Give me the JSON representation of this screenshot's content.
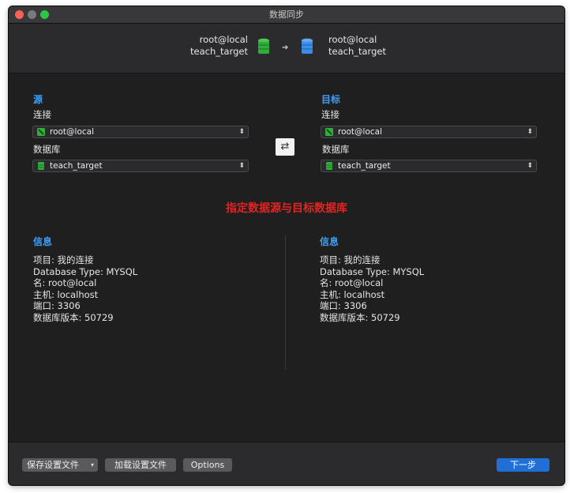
{
  "window": {
    "title": "数据同步"
  },
  "header": {
    "source": {
      "connection": "root@local",
      "database": "teach_target"
    },
    "target": {
      "connection": "root@local",
      "database": "teach_target"
    }
  },
  "source": {
    "title": "源",
    "connection_label": "连接",
    "connection_value": "root@local",
    "database_label": "数据库",
    "database_value": "teach_target"
  },
  "target": {
    "title": "目标",
    "connection_label": "连接",
    "connection_value": "root@local",
    "database_label": "数据库",
    "database_value": "teach_target"
  },
  "notice": "指定数据源与目标数据库",
  "info_left": {
    "title": "信息",
    "lines": [
      "项目: 我的连接",
      "Database Type: MYSQL",
      "名: root@local",
      "主机: localhost",
      "端口: 3306",
      "数据库版本: 50729"
    ]
  },
  "info_right": {
    "title": "信息",
    "lines": [
      "项目: 我的连接",
      "Database Type: MYSQL",
      "名: root@local",
      "主机: localhost",
      "端口: 3306",
      "数据库版本: 50729"
    ]
  },
  "footer": {
    "save_label": "保存设置文件",
    "load_label": "加载设置文件",
    "options_label": "Options",
    "next_label": "下一步"
  },
  "colors": {
    "accent": "#3f9ef5",
    "notice": "#e32420",
    "primary_button": "#1f6fd6",
    "source_db": "#2fae3a",
    "target_db": "#3d8ee8"
  },
  "icons": {
    "source_db": "database-icon-green",
    "target_db": "database-icon-blue",
    "connection": "mysql-connection-icon",
    "swap": "swap-icon"
  }
}
